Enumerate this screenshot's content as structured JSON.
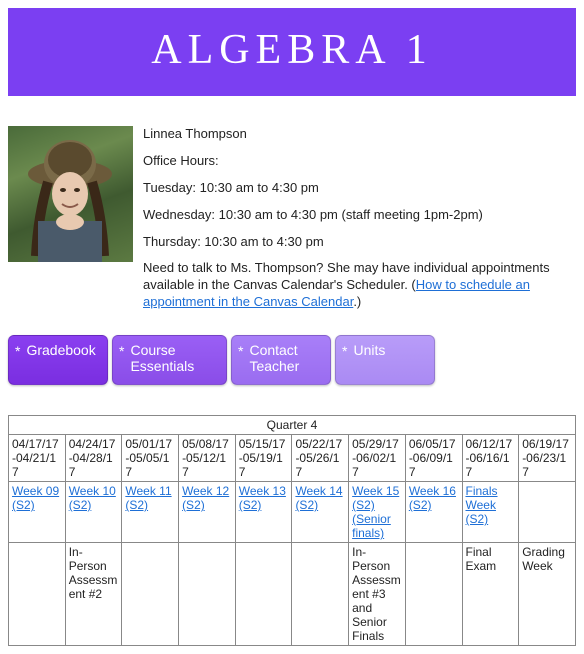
{
  "banner": {
    "title": "ALGEBRA 1"
  },
  "instructor": {
    "name": "Linnea Thompson",
    "office_hours_label": "Office Hours:",
    "hours": [
      "Tuesday: 10:30 am to 4:30 pm",
      "Wednesday: 10:30 am to 4:30 pm (staff meeting 1pm-2pm)",
      "Thursday: 10:30 am to 4:30 pm"
    ],
    "note_prefix": "Need to talk to Ms. Thompson? She may have individual appointments available in the Canvas Calendar's Scheduler. (",
    "note_link": "How to schedule an appointment in the Canvas Calendar",
    "note_suffix": ".)"
  },
  "nav": {
    "gradebook": "Gradebook",
    "essentials": "Course Essentials",
    "contact": "Contact Teacher",
    "units": "Units"
  },
  "schedule": {
    "title": "Quarter 4",
    "columns": [
      {
        "dates": "04/17/17-04/21/17",
        "week": "Week 09 (S2)",
        "note": ""
      },
      {
        "dates": "04/24/17-04/28/17",
        "week": "Week 10 (S2)",
        "note": "In-Person Assessment #2"
      },
      {
        "dates": "05/01/17-05/05/17",
        "week": "Week 11 (S2)",
        "note": ""
      },
      {
        "dates": "05/08/17-05/12/17",
        "week": "Week 12 (S2)",
        "note": ""
      },
      {
        "dates": "05/15/17-05/19/17",
        "week": "Week 13 (S2)",
        "note": ""
      },
      {
        "dates": "05/22/17-05/26/17",
        "week": "Week 14 (S2)",
        "note": ""
      },
      {
        "dates": "05/29/17-06/02/17",
        "week": "Week 15 (S2) (Senior finals)",
        "note": "In-Person Assessment #3 and Senior Finals"
      },
      {
        "dates": "06/05/17-06/09/17",
        "week": "Week 16 (S2)",
        "note": ""
      },
      {
        "dates": "06/12/17-06/16/17",
        "week": "Finals Week (S2)",
        "note": "Final Exam"
      },
      {
        "dates": "06/19/17-06/23/17",
        "week": "",
        "note": "Grading Week"
      }
    ]
  }
}
